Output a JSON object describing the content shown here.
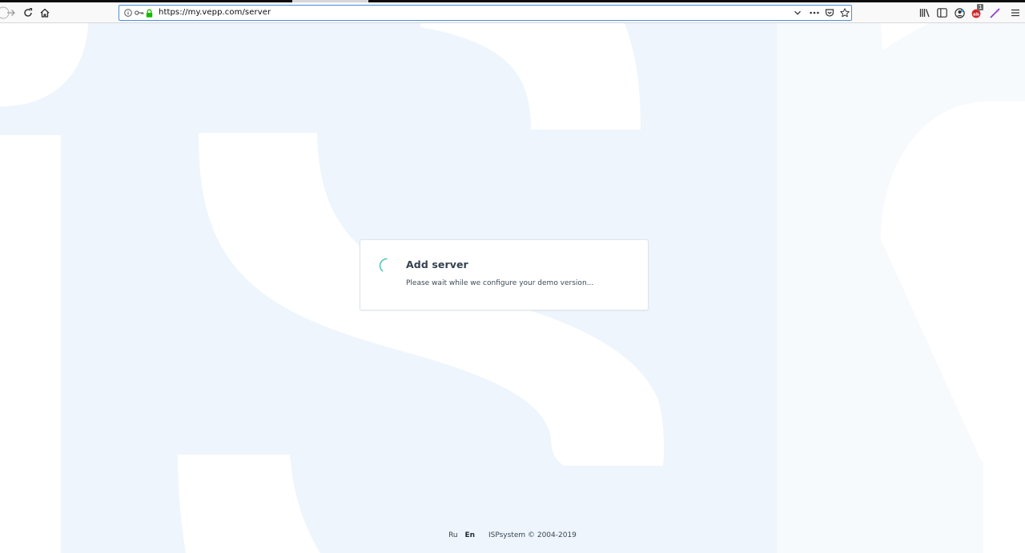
{
  "browser": {
    "url": "https://my.vepp.com/server",
    "notification_count": "1"
  },
  "card": {
    "title": "Add server",
    "message": "Please wait while we configure your demo version..."
  },
  "footer": {
    "lang_ru": "Ru",
    "lang_en": "En",
    "copyright": "ISPsystem © 2004-2019"
  },
  "colors": {
    "accent_green": "#12bc00",
    "spinner": "#5bc7b8",
    "page_bg": "#eef5fc"
  }
}
